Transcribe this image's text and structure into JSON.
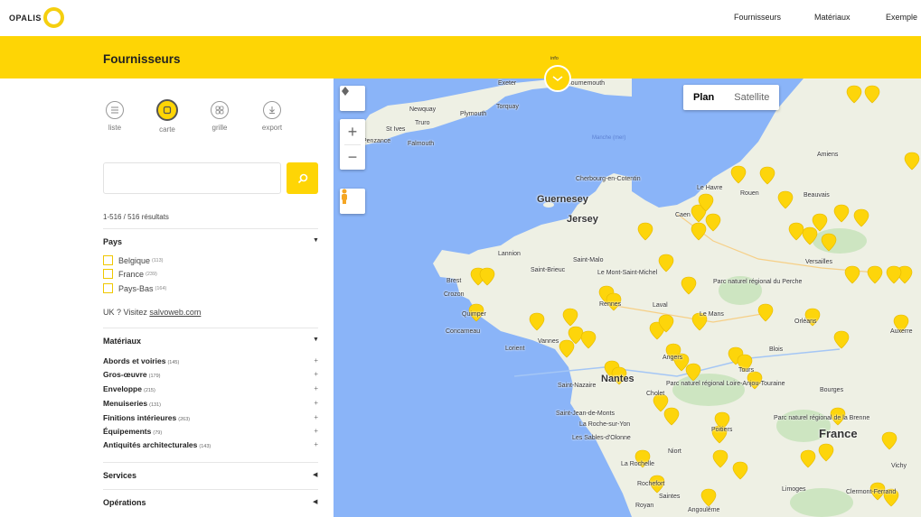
{
  "header": {
    "logo_text": "OPALIS",
    "nav": [
      "Fournisseurs",
      "Matériaux",
      "Exemple"
    ]
  },
  "banner": {
    "title": "Fournisseurs",
    "info_label": "info"
  },
  "views": [
    {
      "label": "liste",
      "icon": "list-icon"
    },
    {
      "label": "carte",
      "icon": "map-icon"
    },
    {
      "label": "grille",
      "icon": "grid-icon"
    },
    {
      "label": "export",
      "icon": "download-icon"
    }
  ],
  "active_view": "carte",
  "search": {
    "value": "",
    "placeholder": ""
  },
  "results": "1-516 / 516 résultats",
  "pays": {
    "title": "Pays",
    "items": [
      {
        "label": "Belgique",
        "count": "(113)"
      },
      {
        "label": "France",
        "count": "(239)"
      },
      {
        "label": "Pays-Bas",
        "count": "(164)"
      }
    ],
    "uk_prefix": "UK ? Visitez ",
    "uk_link": "salvoweb.com"
  },
  "materiaux": {
    "title": "Matériaux",
    "items": [
      {
        "label": "Abords et voiries",
        "count": "(145)"
      },
      {
        "label": "Gros-œuvre",
        "count": "(179)"
      },
      {
        "label": "Enveloppe",
        "count": "(215)"
      },
      {
        "label": "Menuiseries",
        "count": "(131)"
      },
      {
        "label": "Finitions intérieures",
        "count": "(263)"
      },
      {
        "label": "Équipements",
        "count": "(79)"
      },
      {
        "label": "Antiquités architecturales",
        "count": "(143)"
      }
    ]
  },
  "services": {
    "title": "Services"
  },
  "operations": {
    "title": "Opérations"
  },
  "map": {
    "type_plan": "Plan",
    "type_satellite": "Satellite",
    "places": {
      "exeter": "Exeter",
      "bournemouth": "Bournemouth",
      "torquay": "Torquay",
      "newquay": "Newquay",
      "plymouth": "Plymouth",
      "truro": "Truro",
      "stives": "St Ives",
      "penzance": "Penzance",
      "falmouth": "Falmouth",
      "manche": "Manche (mer)",
      "cherbourg": "Cherbourg-en-Cotentin",
      "guernesey": "Guernesey",
      "jersey": "Jersey",
      "caen": "Caen",
      "lehavre": "Le Havre",
      "rouen": "Rouen",
      "beauvais": "Beauvais",
      "amiens": "Amiens",
      "lannion": "Lannion",
      "stmalo": "Saint-Malo",
      "stbrieuc": "Saint-Brieuc",
      "montstmichel": "Le Mont-Saint-Michel",
      "brest": "Brest",
      "crozon": "Crozon",
      "quimper": "Quimper",
      "concarneau": "Concarneau",
      "lorient": "Lorient",
      "vannes": "Vannes",
      "rennes": "Rennes",
      "laval": "Laval",
      "lemans": "Le Mans",
      "parcperche": "Parc naturel régional du Perche",
      "versailles": "Versailles",
      "orleans": "Orléans",
      "auxerre": "Auxerre",
      "blois": "Blois",
      "angers": "Angers",
      "nantes": "Nantes",
      "stnazaire": "Saint-Nazaire",
      "cholet": "Cholet",
      "loireanjou": "Parc naturel régional Loire-Anjou-Touraine",
      "tours": "Tours",
      "bourges": "Bourges",
      "stjeanmonts": "Saint-Jean-de-Monts",
      "larochesuryon": "La Roche-sur-Yon",
      "sablesdolonne": "Les Sables-d'Olonne",
      "poitiers": "Poitiers",
      "brenne": "Parc naturel régional de la Brenne",
      "france": "France",
      "niort": "Niort",
      "larochelle": "La Rochelle",
      "rochefort": "Rochefort",
      "saintes": "Saintes",
      "royan": "Royan",
      "angouleme": "Angoulême",
      "limoges": "Limoges",
      "clermont": "Clermont-Ferrand",
      "vichy": "Vichy"
    }
  },
  "colors": {
    "accent": "#fed505",
    "marker": "#fdd50b",
    "sea": "#8ab4f8",
    "land": "#eef0e4",
    "forest": "#cde5c1"
  }
}
